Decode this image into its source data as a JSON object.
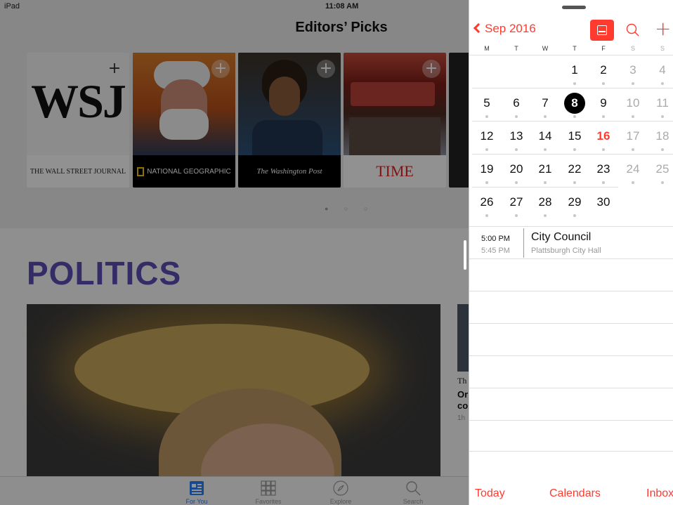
{
  "status_bar": {
    "carrier": "iPad",
    "time": "11:08 AM"
  },
  "news": {
    "title": "Editors’ Picks",
    "publications": [
      {
        "name": "THE WALL STREET JOURNAL",
        "mark": "WSJ"
      },
      {
        "name": "NATIONAL GEOGRAPHIC"
      },
      {
        "name": "The Washington Post"
      },
      {
        "name": "TIME"
      }
    ],
    "section_title": "POLITICS",
    "side_story": {
      "source": "Th",
      "headline": "Or sa co pr",
      "age": "1h"
    },
    "tabs": [
      {
        "label": "For You",
        "icon": "for-you-icon"
      },
      {
        "label": "Favorites",
        "icon": "favorites-icon"
      },
      {
        "label": "Explore",
        "icon": "explore-icon"
      },
      {
        "label": "Search",
        "icon": "search-icon"
      }
    ]
  },
  "calendar": {
    "back_label": "Sep 2016",
    "weekdays": [
      "M",
      "T",
      "W",
      "T",
      "F",
      "S",
      "S"
    ],
    "weeks": [
      [
        "",
        "",
        "",
        "1",
        "2",
        "3",
        "4"
      ],
      [
        "5",
        "6",
        "7",
        "8",
        "9",
        "10",
        "11"
      ],
      [
        "12",
        "13",
        "14",
        "15",
        "16",
        "17",
        "18"
      ],
      [
        "19",
        "20",
        "21",
        "22",
        "23",
        "24",
        "25"
      ],
      [
        "26",
        "27",
        "28",
        "29",
        "30",
        "",
        ""
      ]
    ],
    "today": "8",
    "highlighted": "16",
    "event": {
      "start": "5:00 PM",
      "end": "5:45 PM",
      "title": "City Council",
      "location": "Plattsburgh City Hall"
    },
    "toolbar": {
      "today": "Today",
      "calendars": "Calendars",
      "inbox": "Inbox"
    },
    "colors": {
      "accent": "#ff3b30",
      "event_bar": "#5ac85a"
    }
  }
}
